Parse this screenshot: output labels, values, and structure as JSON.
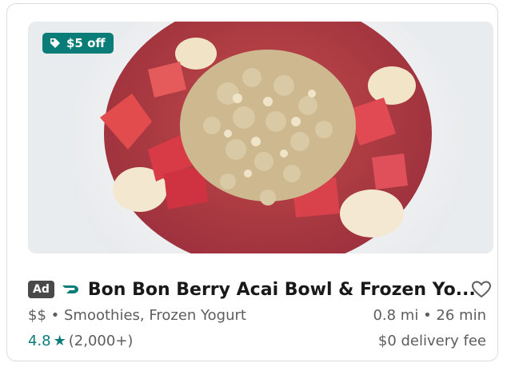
{
  "promo": {
    "label": "$5 off",
    "icon": "tag-icon",
    "color": "#0a7d78"
  },
  "store": {
    "ad_label": "Ad",
    "dashpass_icon": "dashpass-icon",
    "name": "Bon Bon Berry Acai Bowl & Frozen Yo...",
    "price_range": "$$",
    "separator": "•",
    "categories": "Smoothies, Frozen Yogurt",
    "distance": "0.8 mi",
    "eta": "26 min",
    "rating": "4.8",
    "rating_count": "(2,000+)",
    "delivery_fee": "$0 delivery fee",
    "favorite_icon": "heart-icon"
  }
}
